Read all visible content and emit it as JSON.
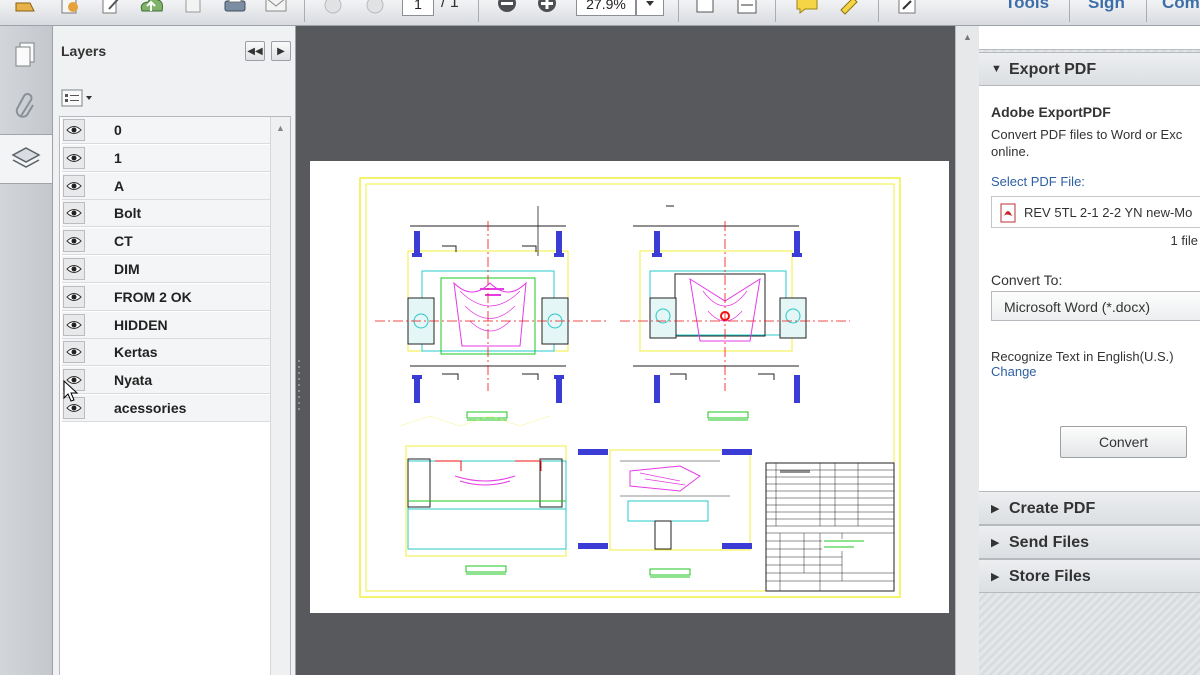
{
  "toolbar": {
    "page_current": "1",
    "page_total": "/ 1",
    "zoom": "27.9%",
    "tools_label": "Tools",
    "sign_label": "Sign",
    "comment_label": "Com"
  },
  "layers_panel": {
    "title": "Layers",
    "layers": [
      "0",
      "1",
      "A",
      "Bolt",
      "CT",
      "DIM",
      "FROM 2 OK",
      "HIDDEN",
      "Kertas",
      "Nyata",
      "acessories"
    ]
  },
  "tools_pane": {
    "export_pdf": {
      "header": "Export PDF",
      "heading": "Adobe ExportPDF",
      "description_line1": "Convert PDF files to Word or Exc",
      "description_line2": "online.",
      "select_file_label": "Select PDF File:",
      "file_name": "REV 5TL 2-1 2-2 YN new-Mo",
      "file_count": "1 file",
      "convert_to_label": "Convert To:",
      "convert_to_value": "Microsoft Word (*.docx)",
      "recognize_text": "Recognize Text in English(U.S.)",
      "change_link": "Change",
      "convert_button": "Convert"
    },
    "sections": [
      "Create PDF",
      "Send Files",
      "Store Files"
    ]
  },
  "colors": {
    "doc_background": "#57595c",
    "drawing_border": "#ffff55",
    "link_blue": "#2d5fa3"
  }
}
